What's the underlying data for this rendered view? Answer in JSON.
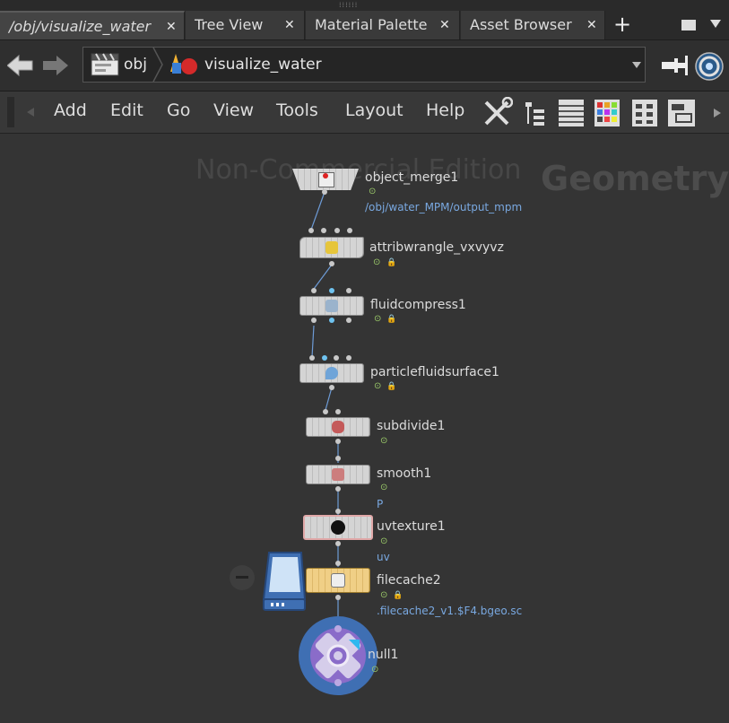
{
  "tabs": [
    {
      "label": "/obj/visualize_water",
      "active": true
    },
    {
      "label": "Tree View",
      "active": false
    },
    {
      "label": "Material Palette",
      "active": false
    },
    {
      "label": "Asset Browser",
      "active": false
    }
  ],
  "tab_close_glyph": "✕",
  "add_tab_glyph": "+",
  "path": {
    "context": "obj",
    "node": "visualize_water"
  },
  "menu": [
    "Add",
    "Edit",
    "Go",
    "View",
    "Tools",
    "Layout",
    "Help"
  ],
  "watermark": "Non-Commercial Edition",
  "context_label": "Geometry",
  "nodes": [
    {
      "name": "object_merge1",
      "param": "/obj/water_MPM/output_mpm"
    },
    {
      "name": "attribwrangle_vxvyvz",
      "param": ""
    },
    {
      "name": "fluidcompress1",
      "param": ""
    },
    {
      "name": "particlefluidsurface1",
      "param": ""
    },
    {
      "name": "subdivide1",
      "param": ""
    },
    {
      "name": "smooth1",
      "param": "P"
    },
    {
      "name": "uvtexture1",
      "param": "uv"
    },
    {
      "name": "filecache2",
      "param": ".filecache2_v1.$F4.bgeo.sc"
    },
    {
      "name": "null1",
      "param": ""
    }
  ],
  "colors": {
    "accent_blue": "#79a8e0",
    "display_flag": "#9fd06b",
    "filecache_node": "#f0cf86",
    "null_badge": "#3f6fb3",
    "null_inner": "#8a6cc9"
  }
}
